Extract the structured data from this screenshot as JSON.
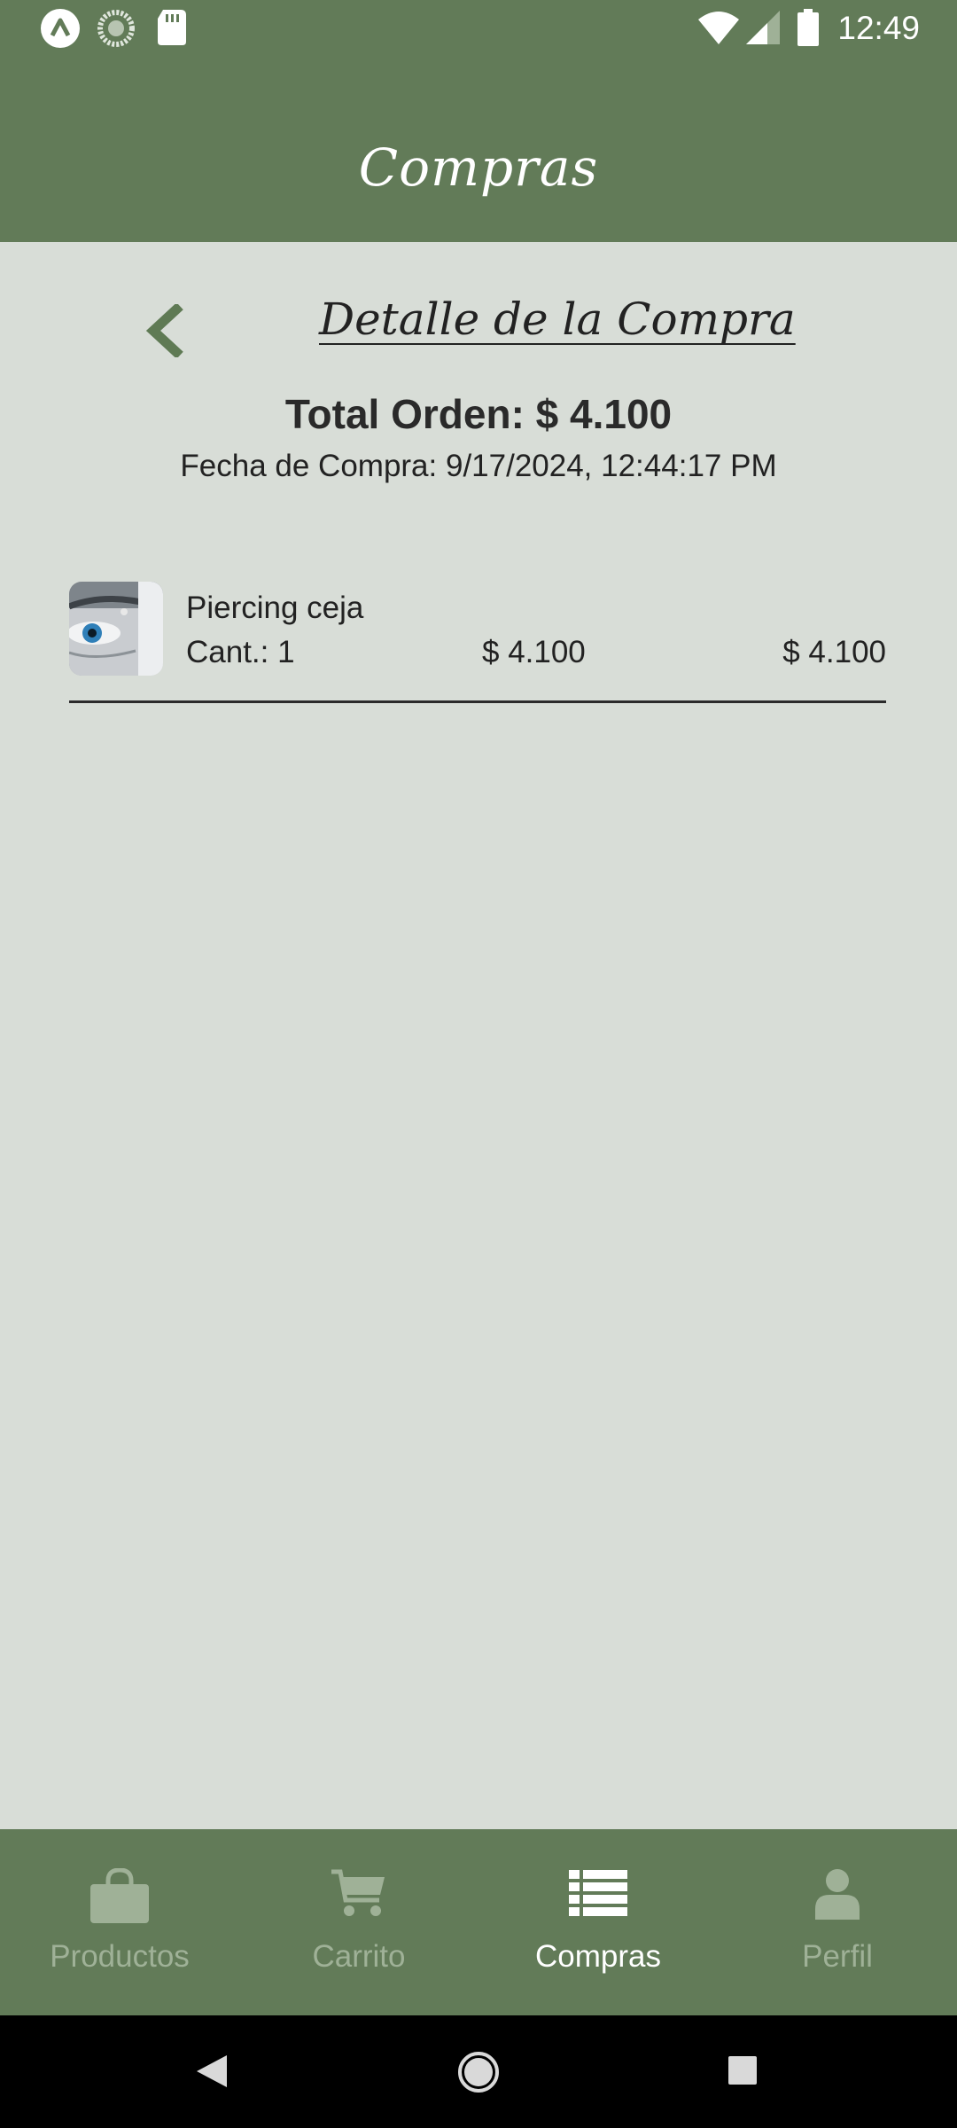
{
  "status_bar": {
    "time": "12:49",
    "icons": [
      "expo-icon",
      "sync-icon",
      "sd-card-icon",
      "wifi-icon",
      "signal-icon",
      "battery-icon"
    ]
  },
  "header": {
    "title": "Compras"
  },
  "detail": {
    "title": "Detalle de la Compra",
    "total": "Total Orden: $ 4.100",
    "date": "Fecha de Compra: 9/17/2024, 12:44:17 PM",
    "items": [
      {
        "name": "Piercing ceja",
        "qty": "Cant.: 1",
        "unit_price": "$ 4.100",
        "line_total": "$ 4.100",
        "image": "eyebrow-piercing-photo"
      }
    ]
  },
  "bottom_nav": {
    "tabs": [
      {
        "label": "Productos",
        "icon": "shopping-bag-icon",
        "active": false
      },
      {
        "label": "Carrito",
        "icon": "cart-icon",
        "active": false
      },
      {
        "label": "Compras",
        "icon": "list-icon",
        "active": true
      },
      {
        "label": "Perfil",
        "icon": "user-icon",
        "active": false
      }
    ]
  },
  "colors": {
    "primary": "#627b58",
    "background": "#d8ddd7",
    "inactive_tab": "#9fb197",
    "active_tab": "#ffffff",
    "back_arrow": "#5f7a54"
  }
}
